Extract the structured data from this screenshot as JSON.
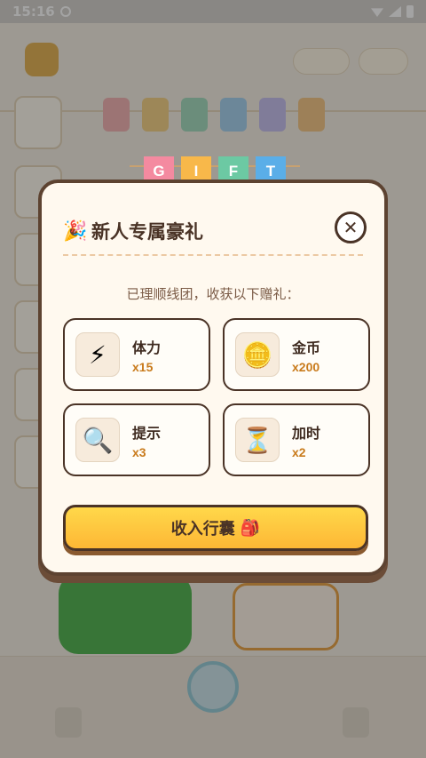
{
  "status_bar": {
    "time": "15:16"
  },
  "gift_banner": {
    "letters": [
      {
        "char": "G",
        "color": "#f48aa0"
      },
      {
        "char": "I",
        "color": "#f8b84a"
      },
      {
        "char": "F",
        "color": "#6cc9a3"
      },
      {
        "char": "T",
        "color": "#5aaee8"
      }
    ]
  },
  "modal": {
    "title": "新人专属豪礼",
    "party_icon": "party-popper-icon",
    "close_icon": "close-icon",
    "close_symbol": "✕",
    "subtitle": "已理顺线团，收获以下赠礼：",
    "rewards": [
      {
        "icon": "⚡",
        "icon_name": "lightning-icon",
        "name": "体力",
        "amount": "x15"
      },
      {
        "icon": "🪙",
        "icon_name": "coin-icon",
        "name": "金币",
        "amount": "x200"
      },
      {
        "icon": "🔍",
        "icon_name": "magnifier-icon",
        "name": "提示",
        "amount": "x3"
      },
      {
        "icon": "⏳",
        "icon_name": "hourglass-icon",
        "name": "加时",
        "amount": "x2"
      }
    ],
    "collect_button": "收入行囊",
    "bag_icon": "🎒"
  },
  "colors": {
    "modal_border": "#5d4331",
    "button_yellow": "#fdc83d",
    "amount_orange": "#c97b1c"
  }
}
